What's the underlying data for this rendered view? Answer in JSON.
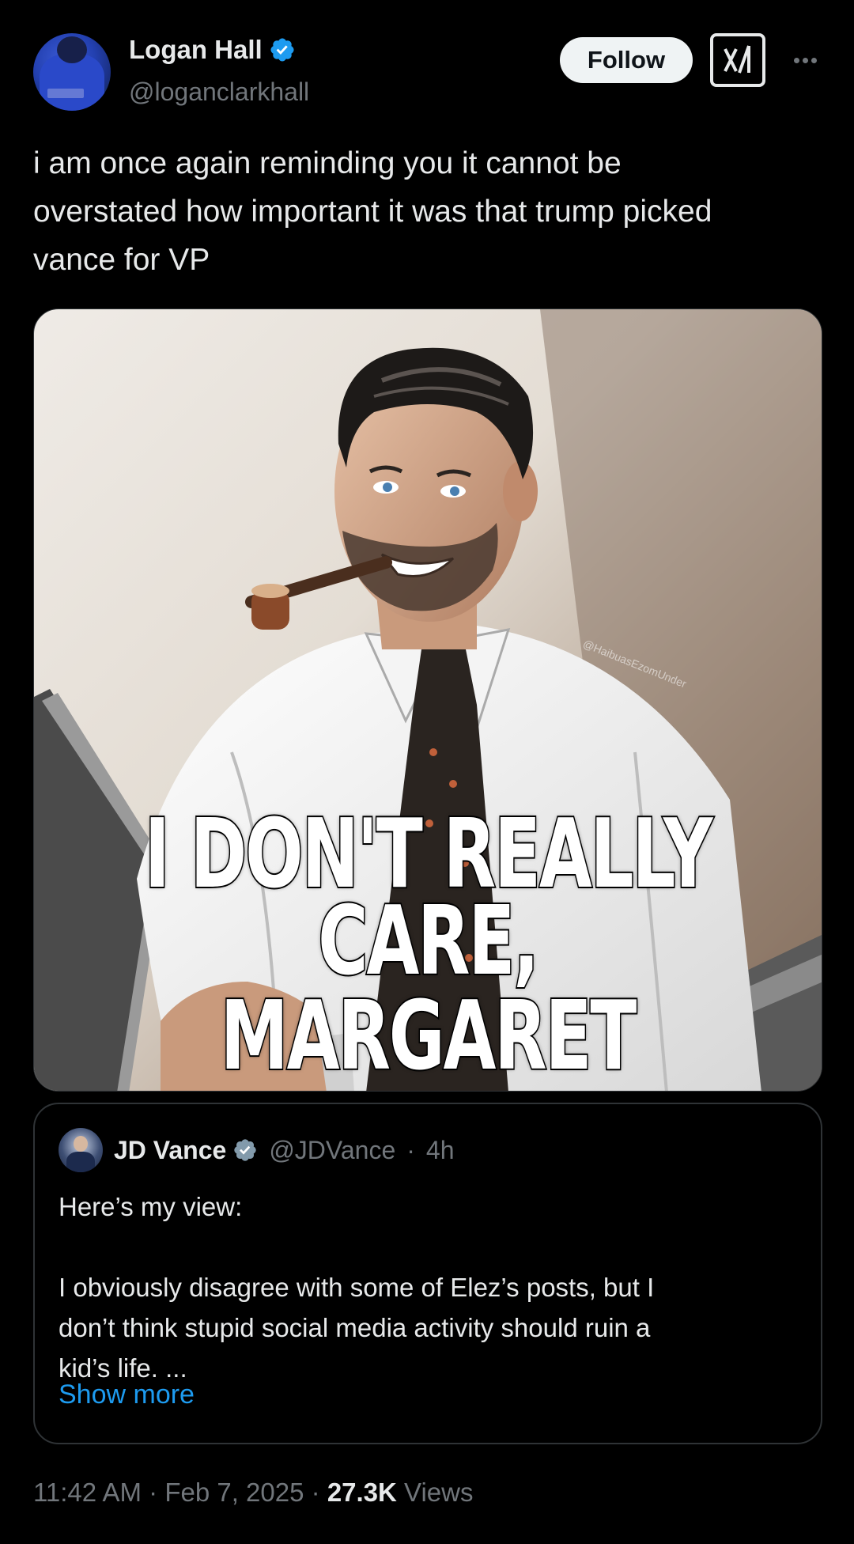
{
  "author": {
    "display_name": "Logan Hall",
    "handle": "@loganclarkhall",
    "verified": true
  },
  "actions": {
    "follow_label": "Follow",
    "grok_icon": "grok-icon",
    "more_icon": "more-dots-icon"
  },
  "tweet": {
    "text": "i am once again reminding you it cannot be\noverstated how important it was that trump picked\nvance for VP"
  },
  "media": {
    "caption_line1": "I DON'T REALLY",
    "caption_line2": "CARE, MARGARET",
    "watermark": "@HaibuasEzomUnder"
  },
  "quote": {
    "display_name": "JD Vance",
    "handle": "@JDVance",
    "separator": "·",
    "time": "4h",
    "verified": true,
    "text": "Here’s my view:\n\nI obviously disagree with some of Elez’s posts, but I\ndon’t think stupid social media activity should ruin a\nkid’s life. ...",
    "show_more": "Show more"
  },
  "meta": {
    "time": "11:42 AM",
    "sep1": "·",
    "date": "Feb 7, 2025",
    "sep2": "·",
    "views_count": "27.3K",
    "views_label": "Views"
  },
  "colors": {
    "background": "#000000",
    "text": "#e7e9ea",
    "muted": "#71767b",
    "link": "#1d9bf0",
    "verified": "#1d9bf0",
    "border": "#2f3336"
  }
}
